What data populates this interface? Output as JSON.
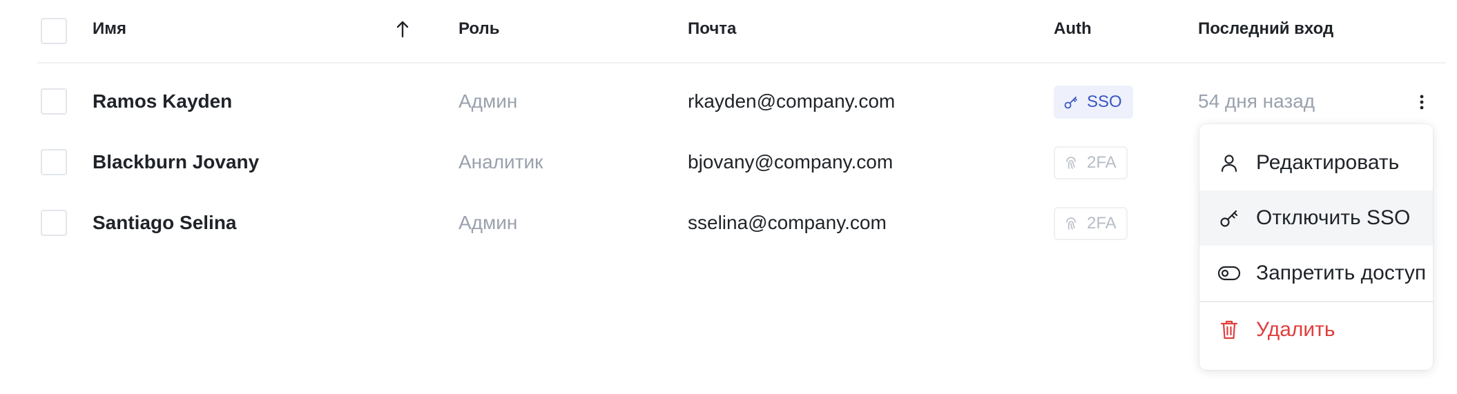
{
  "table": {
    "header": {
      "name": "Имя",
      "role": "Роль",
      "email": "Почта",
      "auth": "Auth",
      "last_login": "Последний вход",
      "sort_icon": "arrow-up-icon"
    },
    "rows": [
      {
        "name": "Ramos Kayden",
        "role": "Админ",
        "email": "rkayden@company.com",
        "auth": "SSO",
        "auth_icon": "key-icon",
        "last_login": "54 дня назад"
      },
      {
        "name": "Blackburn Jovany",
        "role": "Аналитик",
        "email": "bjovany@company.com",
        "auth": "2FA",
        "auth_icon": "fingerprint-icon",
        "last_login": ""
      },
      {
        "name": "Santiago Selina",
        "role": "Админ",
        "email": "sselina@company.com",
        "auth": "2FA",
        "auth_icon": "fingerprint-icon",
        "last_login": ""
      }
    ]
  },
  "context_menu": {
    "items": [
      {
        "label": "Редактировать",
        "icon": "user-icon"
      },
      {
        "label": "Отключить SSO",
        "icon": "key-icon"
      },
      {
        "label": "Запретить доступ",
        "icon": "toggle-icon"
      },
      {
        "label": "Удалить",
        "icon": "trash-icon"
      }
    ]
  },
  "colors": {
    "sso_badge_bg": "#eef1fb",
    "sso_badge_text": "#3b55c4",
    "muted_text": "#9aa1ad",
    "danger": "#e03e3e",
    "menu_hover": "#f4f5f7"
  }
}
